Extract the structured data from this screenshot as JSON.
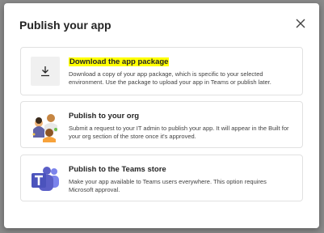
{
  "dialog": {
    "title": "Publish your app",
    "close_icon": "close-icon"
  },
  "options": [
    {
      "heading": "Download the app package",
      "description": "Download a copy of your app package, which is specific to your selected environment. Use the package to upload your app in Teams or publish later.",
      "icon": "download-icon",
      "highlighted": true
    },
    {
      "heading": "Publish to your org",
      "description": "Submit a request to your IT admin to publish your app. It will appear in the Built for your org section of the store once it's approved.",
      "icon": "people-illustration-icon"
    },
    {
      "heading": "Publish to the Teams store",
      "description": "Make your app available to Teams users everywhere. This option requires Microsoft approval.",
      "icon": "teams-logo-icon"
    }
  ],
  "colors": {
    "highlight": "#ffff00",
    "teams_purple": "#5b5fc7"
  }
}
